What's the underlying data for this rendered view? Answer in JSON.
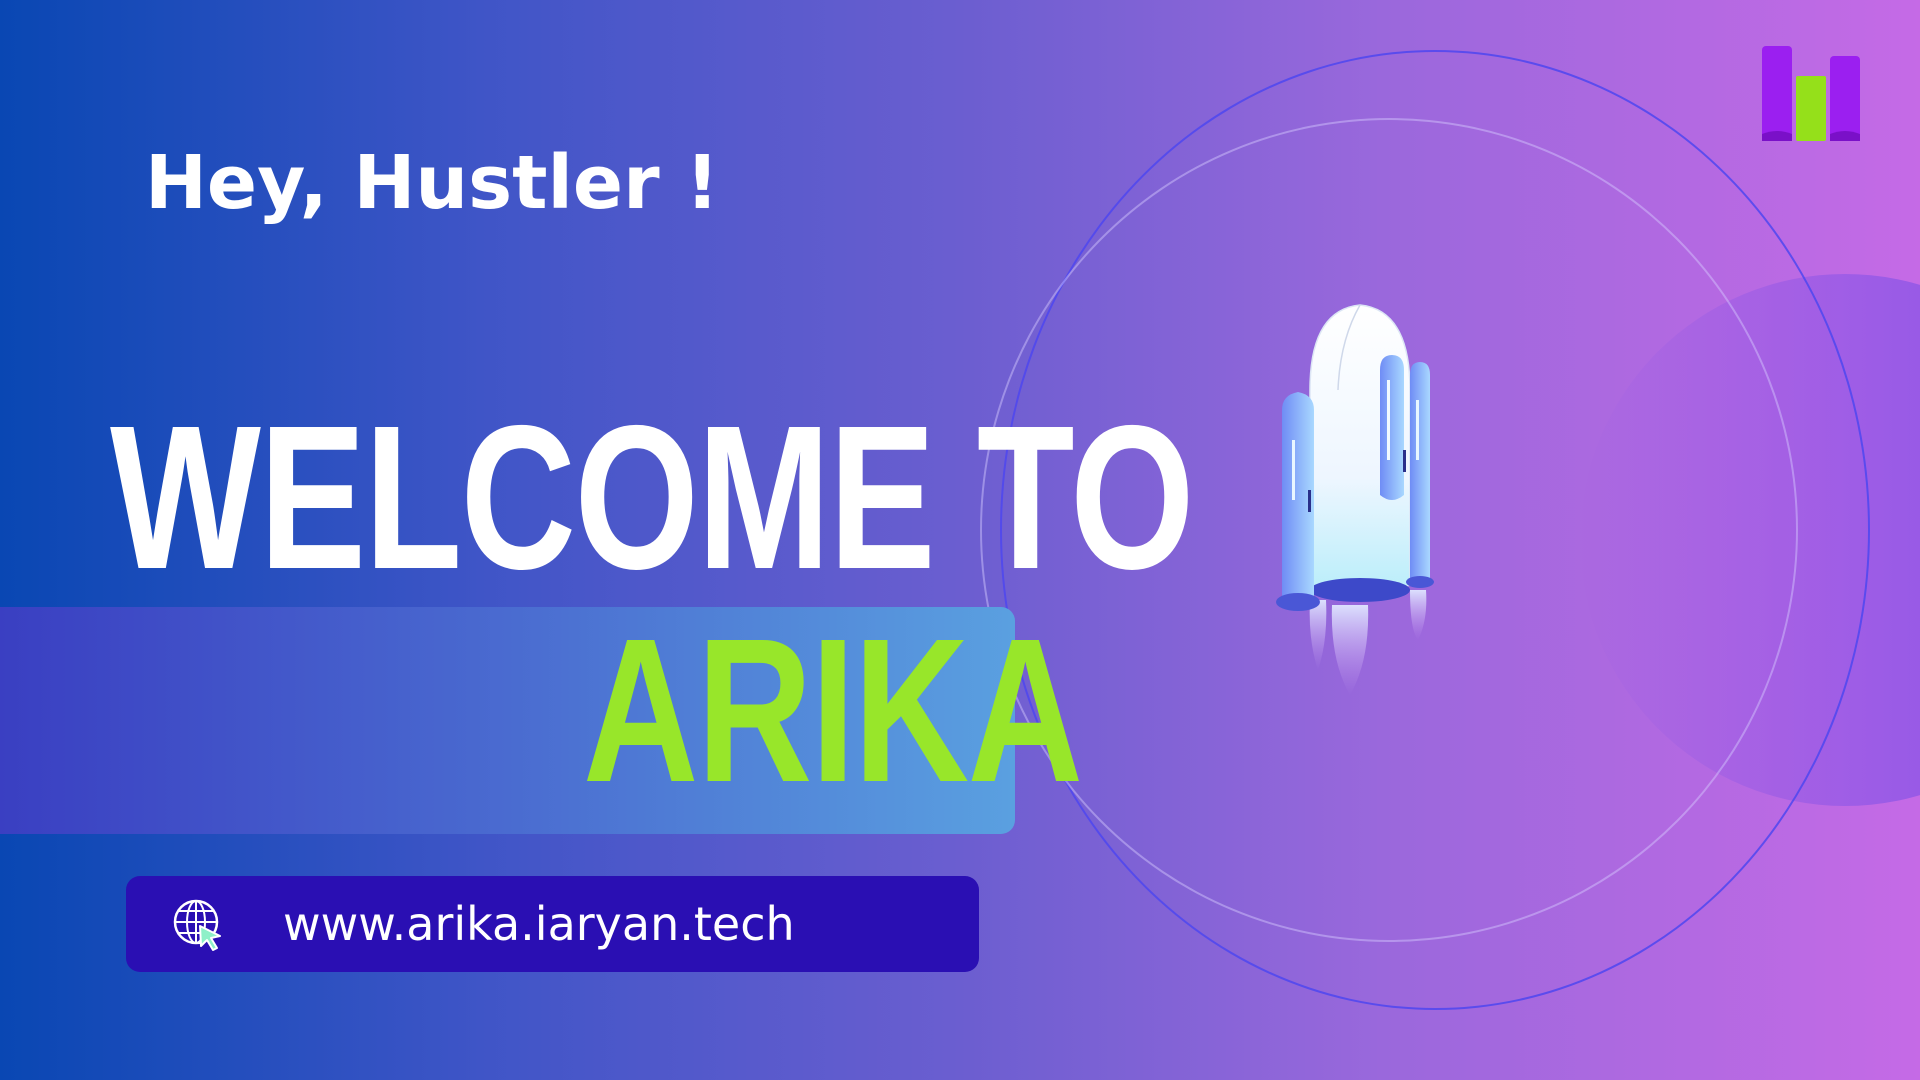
{
  "greeting": "Hey, Hustler !",
  "headline": "WELCOME TO",
  "brand": "ARIKA",
  "website": {
    "url": "www.arika.iaryan.tech",
    "icon": "globe-cursor-icon"
  },
  "logo": {
    "icon": "arika-logo"
  },
  "illustration": {
    "icon": "rocket-icon"
  },
  "colors": {
    "gradient_start": "#0947b3",
    "gradient_end": "#c56ae6",
    "brand_green": "#98e62a",
    "url_pill": "#2a0fb3",
    "logo_purple": "#9b1ff0",
    "logo_green": "#95e01a"
  }
}
